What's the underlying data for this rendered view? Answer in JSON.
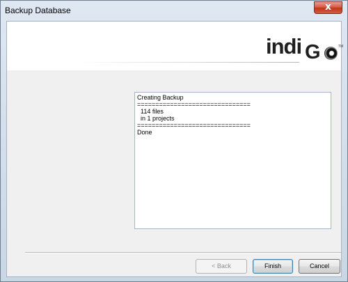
{
  "window": {
    "title": "Backup Database",
    "close_glyph": "x"
  },
  "logo": {
    "text_part1": "indi",
    "text_part2": "G",
    "tm": "TM"
  },
  "log": {
    "text": "Creating Backup\n===============================\n  114 files\n  in 1 projects\n===============================\nDone"
  },
  "buttons": {
    "back": "< Back",
    "finish": "Finish",
    "cancel": "Cancel"
  }
}
